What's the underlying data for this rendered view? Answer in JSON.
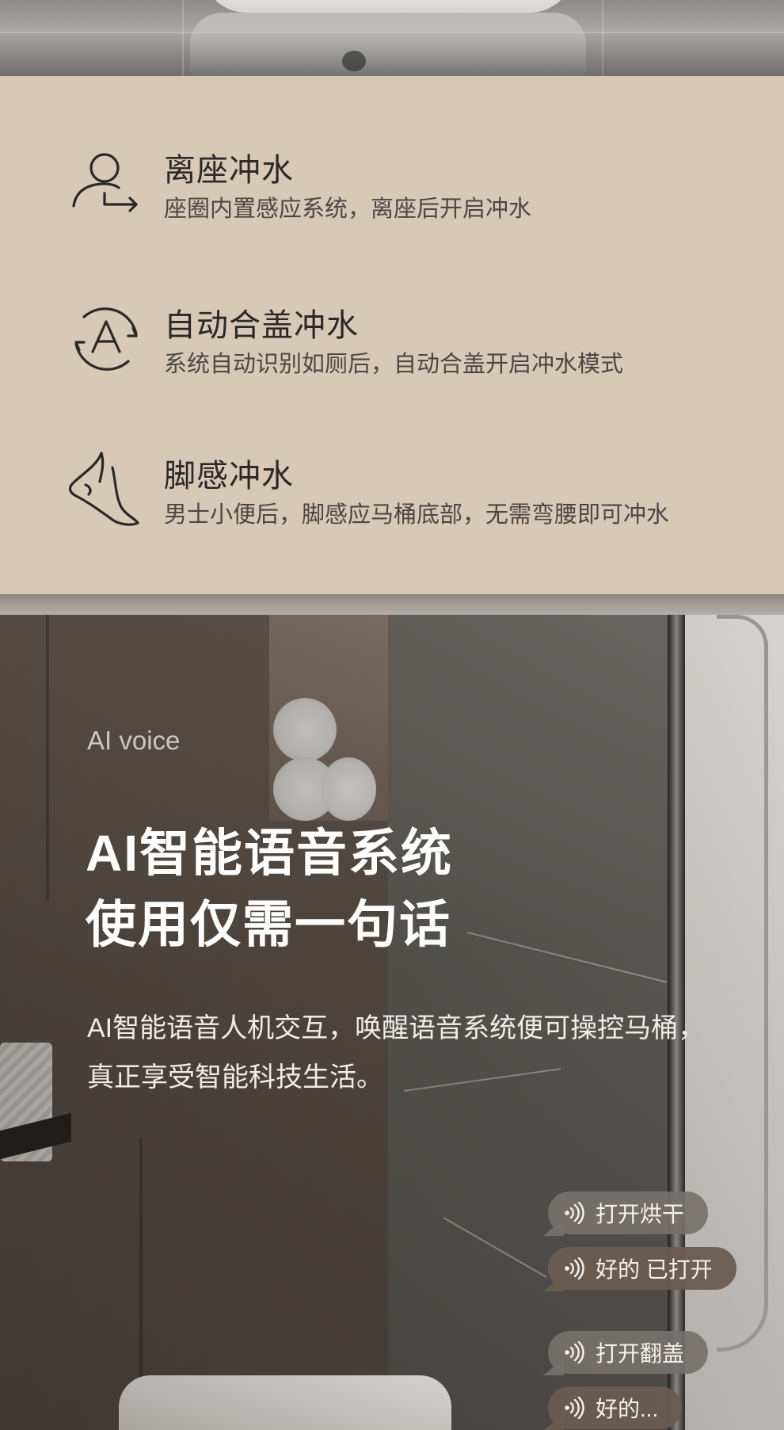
{
  "features": [
    {
      "icon": "person-leaving-seat-icon",
      "title": "离座冲水",
      "description": "座圈内置感应系统，离座后开启冲水"
    },
    {
      "icon": "auto-cycle-A-icon",
      "title": "自动合盖冲水",
      "description": "系统自动识别如厕后，自动合盖开启冲水模式"
    },
    {
      "icon": "foot-icon",
      "title": "脚感冲水",
      "description": "男士小便后，脚感应马桶底部，无需弯腰即可冲水"
    }
  ],
  "ai_section": {
    "eyebrow": "AI voice",
    "headline_line1": "AI智能语音系统",
    "headline_line2": "使用仅需一句话",
    "body_line1": "AI智能语音人机交互，唤醒语音系统便可操控马桶，",
    "body_line2": "真正享受智能科技生活。",
    "chat": [
      {
        "role": "user",
        "text": "打开烘干"
      },
      {
        "role": "reply",
        "text": "好的 已打开"
      },
      {
        "role": "user",
        "text": "打开翻盖"
      },
      {
        "role": "reply",
        "text": "好的..."
      }
    ]
  },
  "colors": {
    "features_bg": "#d8c8b6",
    "title_text": "#2b2825",
    "desc_text": "#4d4741"
  }
}
